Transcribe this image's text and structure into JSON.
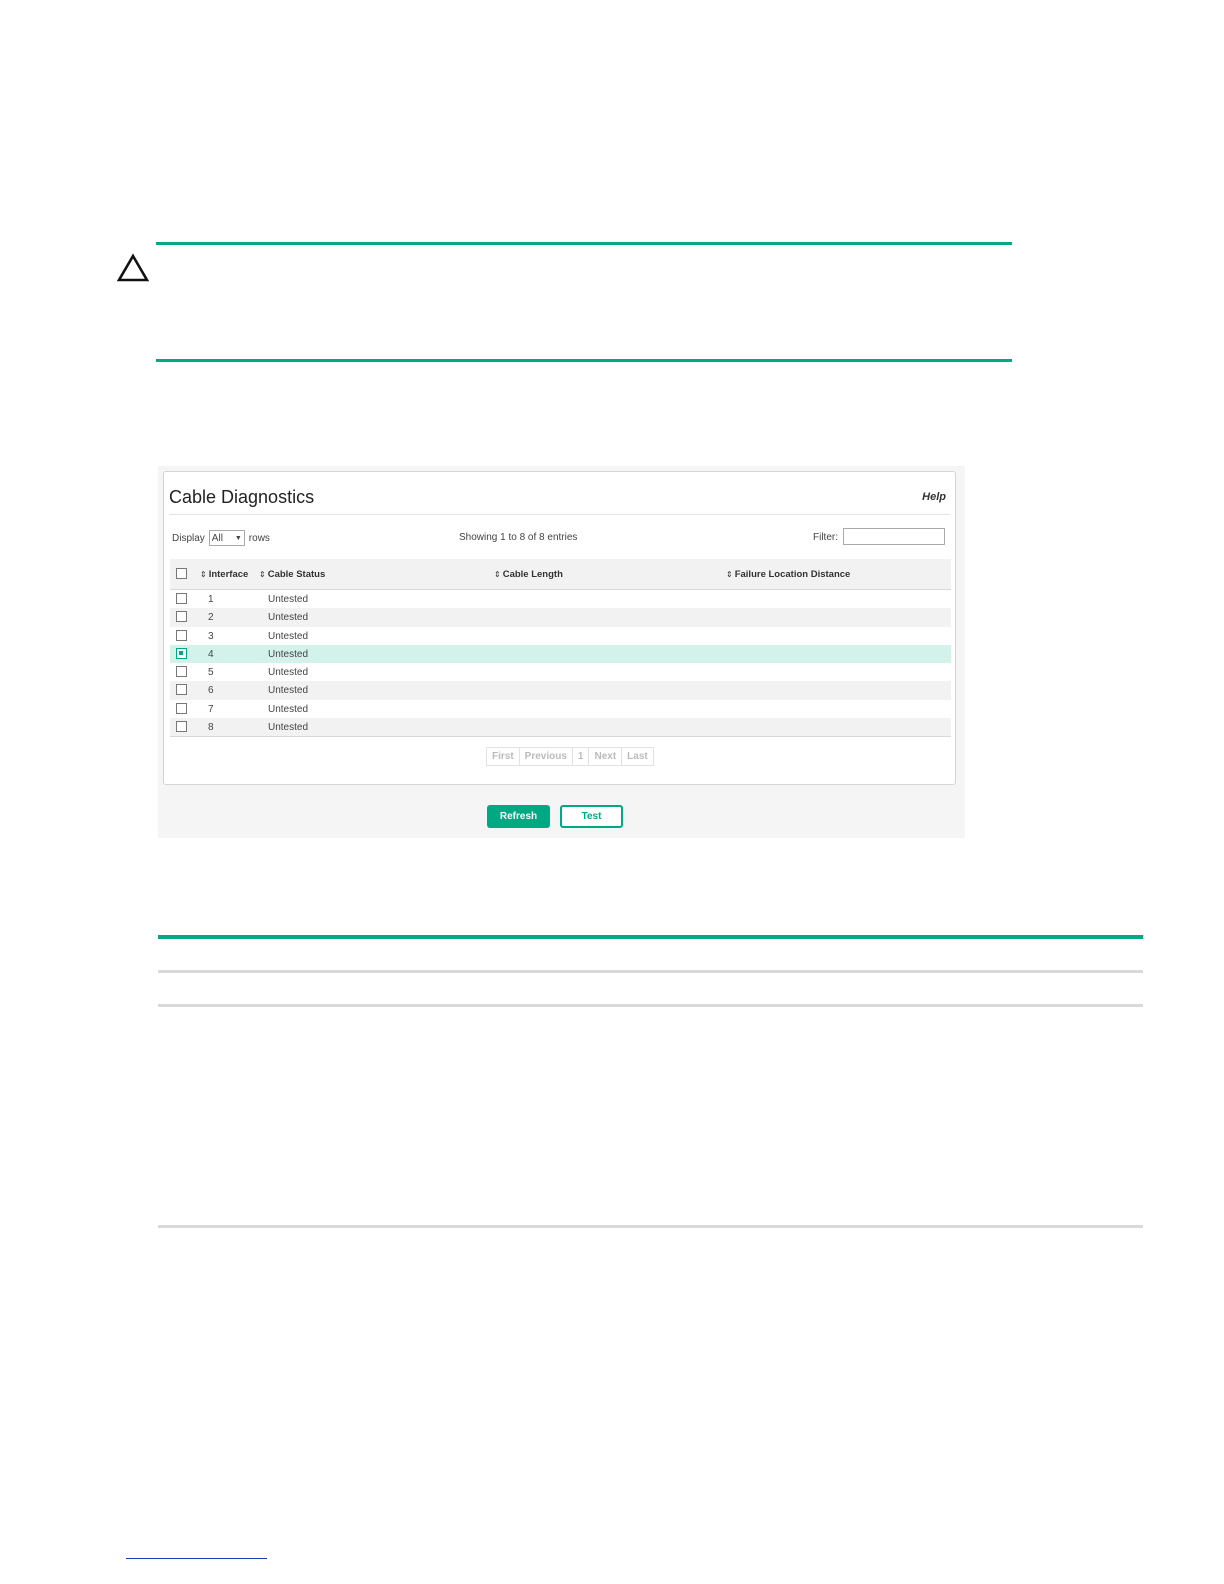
{
  "panel": {
    "title": "Cable Diagnostics",
    "help_label": "Help"
  },
  "controls": {
    "display_label": "Display",
    "display_value": "All",
    "rows_label": "rows",
    "showing_text": "Showing 1 to 8 of 8 entries",
    "filter_label": "Filter:",
    "filter_value": ""
  },
  "table": {
    "columns": [
      "Interface",
      "Cable Status",
      "Cable Length",
      "Failure Location Distance"
    ],
    "rows": [
      {
        "interface": "1",
        "status": "Untested",
        "length": "",
        "failure_distance": "",
        "checked": false
      },
      {
        "interface": "2",
        "status": "Untested",
        "length": "",
        "failure_distance": "",
        "checked": false
      },
      {
        "interface": "3",
        "status": "Untested",
        "length": "",
        "failure_distance": "",
        "checked": false
      },
      {
        "interface": "4",
        "status": "Untested",
        "length": "",
        "failure_distance": "",
        "checked": true
      },
      {
        "interface": "5",
        "status": "Untested",
        "length": "",
        "failure_distance": "",
        "checked": false
      },
      {
        "interface": "6",
        "status": "Untested",
        "length": "",
        "failure_distance": "",
        "checked": false
      },
      {
        "interface": "7",
        "status": "Untested",
        "length": "",
        "failure_distance": "",
        "checked": false
      },
      {
        "interface": "8",
        "status": "Untested",
        "length": "",
        "failure_distance": "",
        "checked": false
      }
    ]
  },
  "pager": {
    "first": "First",
    "previous": "Previous",
    "page": "1",
    "next": "Next",
    "last": "Last"
  },
  "buttons": {
    "refresh": "Refresh",
    "test": "Test"
  },
  "colors": {
    "accent": "#01a982",
    "selected_row": "#d3f2ea"
  }
}
